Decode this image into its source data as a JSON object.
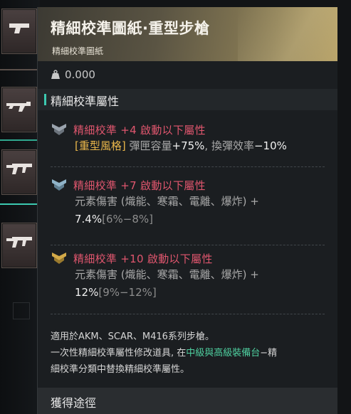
{
  "item": {
    "title": "精細校準圖紙·重型步槍",
    "subtitle": "精細校準圖紙",
    "weight": "0.000"
  },
  "section": {
    "title": "精細校準屬性"
  },
  "attributes": [
    {
      "label": "精細校準 +4 啟動以下屬性",
      "tag": "[重型風格]",
      "text": " 彈匣容量",
      "value": "+75%",
      "text2": ", 換彈效率",
      "value2": "−10%",
      "tier_color": "#9aa3ad"
    },
    {
      "label": "精細校準 +7 啟動以下屬性",
      "text": "元素傷害 (熾能、寒霜、電離、爆炸) +",
      "value": "7.4%",
      "range": "[6%−8%]",
      "tier_color": "#8fb3c8"
    },
    {
      "label": "精細校準 +10 啟動以下屬性",
      "text": "元素傷害 (熾能、寒霜、電離、爆炸) +",
      "value": "12%",
      "range": "[9%−12%]",
      "tier_color": "#d3a948"
    }
  ],
  "description": {
    "line1": "適用於AKM、SCAR、M416系列步槍。",
    "line2_a": "一次性精細校準屬性修改道具, 在",
    "line2_hl": "中級與高級裝備台",
    "line2_b": "−精",
    "line3": "細校準分類中替換精細校準屬性。"
  },
  "footer": {
    "title": "獲得途徑"
  },
  "colors": {
    "accent_teal": "#3cc9b0",
    "attr_pink": "#e0566e",
    "tag_gold": "#e8b54a",
    "highlight_green": "#4fd0a0"
  },
  "icons": {
    "weight": "weight-icon",
    "attr": "chevron-emblem-icon",
    "slots": [
      "pistol-icon",
      "smg-icon",
      "rifle-icon",
      "rifle-icon"
    ]
  }
}
